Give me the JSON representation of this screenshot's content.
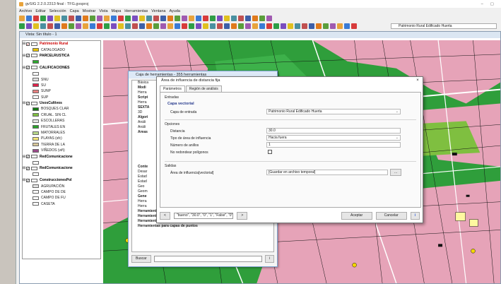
{
  "window": {
    "title": "gvSIG 2.2.0.2313 final : TFG.gvsproj",
    "controls": [
      "–",
      "▢"
    ]
  },
  "menubar": [
    "Archivo",
    "Editar",
    "Selección",
    "Capa",
    "Mostrar",
    "Vista",
    "Mapa",
    "Herramientas",
    "Ventana",
    "Ayuda"
  ],
  "toolbar": {
    "active_layer": "Patrimonio Rural Edificado Huerta"
  },
  "view": {
    "title": "Vista: Sin título - 1"
  },
  "toc": [
    {
      "kind": "layer",
      "label": "Patrimonio Rural",
      "red": true
    },
    {
      "kind": "legend",
      "label": "CATALOGADO",
      "color": "#e8c400"
    },
    {
      "kind": "layer",
      "label": "PARCELRUSTICA",
      "red": false
    },
    {
      "kind": "legend",
      "label": "",
      "color": "#2ea82e"
    },
    {
      "kind": "layer",
      "label": "CALIFICACIONES",
      "red": false
    },
    {
      "kind": "legend",
      "label": "",
      "color": "#ffffff"
    },
    {
      "kind": "legend",
      "label": "SNU",
      "color": "#dcdcdc"
    },
    {
      "kind": "legend",
      "label": "SU",
      "color": "#e0224a"
    },
    {
      "kind": "legend",
      "label": "SUNP",
      "color": "#e88080"
    },
    {
      "kind": "legend",
      "label": "SUP",
      "color": "#ffffff"
    },
    {
      "kind": "layer",
      "label": "UsosCultivos",
      "red": false
    },
    {
      "kind": "legend",
      "label": "BOSQUES CLAR",
      "color": "#147a14"
    },
    {
      "kind": "legend",
      "label": "CRUAL. SIN CL",
      "color": "#7fbf40"
    },
    {
      "kind": "legend",
      "label": "ESCOLLERAS",
      "color": "#e6e6e6"
    },
    {
      "kind": "legend",
      "label": "FRUTALES EN",
      "color": "#2aa02a"
    },
    {
      "kind": "legend",
      "label": "MATORRALES",
      "color": "#b8d98a"
    },
    {
      "kind": "legend",
      "label": "PLAYAS (sfc)",
      "color": "#f3e57a"
    },
    {
      "kind": "legend",
      "label": "TIERRA DE LA",
      "color": "#d8c79a"
    },
    {
      "kind": "legend",
      "label": "VIÑEDOS (viñ)",
      "color": "#9a4a8a"
    },
    {
      "kind": "layer",
      "label": "RedComunicacione",
      "red": false
    },
    {
      "kind": "legend",
      "label": "",
      "color": "#ffffff"
    },
    {
      "kind": "layer",
      "label": "RedComunicacione",
      "red": false
    },
    {
      "kind": "legend",
      "label": "",
      "color": "#ffffff"
    },
    {
      "kind": "layer",
      "label": "ConstruccionesPol",
      "red": false
    },
    {
      "kind": "legend",
      "label": "AGRUPACIÓN",
      "color": "#e3e3e3"
    },
    {
      "kind": "legend",
      "label": "CAMPO DE DE",
      "color": "#ffffff"
    },
    {
      "kind": "legend",
      "label": "CAMPO DE FU",
      "color": "#ffffff"
    },
    {
      "kind": "legend",
      "label": "CASETA",
      "color": "#ffffff"
    }
  ],
  "toolbox": {
    "title": "Caja de herramientas - 355 herramientas",
    "tree": [
      {
        "label": "Básica",
        "bold": false
      },
      {
        "label": "Modi",
        "bold": true
      },
      {
        "label": "Herra",
        "bold": false
      },
      {
        "label": "Script",
        "bold": true
      },
      {
        "label": "Herra",
        "bold": false
      },
      {
        "label": "SEXTA",
        "bold": true
      },
      {
        "label": "3D",
        "bold": false
      },
      {
        "label": "Algori",
        "bold": true
      },
      {
        "label": "Análi",
        "bold": false
      },
      {
        "label": "Análi",
        "bold": false
      },
      {
        "label": "Áreas",
        "bold": true
      },
      {
        "label": "",
        "bold": false
      },
      {
        "label": "",
        "bold": false
      },
      {
        "label": "",
        "bold": false
      },
      {
        "label": "",
        "bold": false
      },
      {
        "label": "",
        "bold": false
      },
      {
        "label": "",
        "bold": false
      },
      {
        "label": "Conte",
        "bold": true
      },
      {
        "label": "Desar",
        "bold": false
      },
      {
        "label": "Estad",
        "bold": false
      },
      {
        "label": "Estad",
        "bold": false
      },
      {
        "label": "Geo",
        "bold": false
      },
      {
        "label": "Geom",
        "bold": false
      },
      {
        "label": "Gene",
        "bold": true
      },
      {
        "label": "Herra",
        "bold": false
      },
      {
        "label": "Herra",
        "bold": false
      },
      {
        "label": "Herramientas de cálculo para capas ráster",
        "bold": true
      },
      {
        "label": "Herramientas para capas de líneas",
        "bold": true
      },
      {
        "label": "Herramientas para capas de polígonos",
        "bold": true
      },
      {
        "label": "Herramientas para capas de puntos",
        "bold": true
      }
    ],
    "search_button": "Buscar",
    "info_button": "i"
  },
  "dialog": {
    "title": "Área de influencia de distancia fija",
    "close": "×",
    "tabs": [
      "Parámetros",
      "Región de análisis"
    ],
    "inputs_section": "Entradas",
    "vector_layers_label": "Capa vectorial",
    "input_layer_label": "Capa de entrada",
    "input_layer_value": "Patrimonio Rural Edificado Huerta",
    "options_section": "Opciones",
    "distance_label": "Distancia",
    "distance_value": "30.0",
    "influence_type_label": "Tipo de área de influencia",
    "influence_type_value": "Hacia fuera",
    "rings_label": "Número de anillos",
    "rings_value": "1",
    "no_round_label": "No redondear polígonos",
    "outputs_section": "Salidas",
    "output_label": "Área de influencia[vectorial]",
    "output_value": "[Guardar en archivo temporal]",
    "browse_button": "...",
    "code_preview": "\"bueno\", \"30.0\", \"0\", \"1\", \"False\", \"0\"",
    "nav_left": "<",
    "nav_right": ">",
    "accept_button": "Aceptar",
    "cancel_button": "Cancelar",
    "help_button": "i"
  },
  "colors": {
    "map_green": "#2f9e3b",
    "urban_pink": "#e6a3b8",
    "ui_blue": "#dde9f7"
  }
}
